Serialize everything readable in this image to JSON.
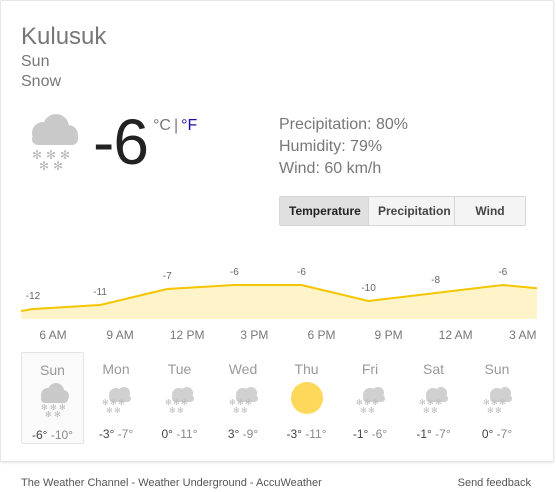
{
  "location": "Kulusuk",
  "day": "Sun",
  "condition": "Snow",
  "current": {
    "temp": "-6",
    "unit_c": "°C",
    "unit_sep": "|",
    "unit_f": "°F",
    "icon": "snow-cloud-icon"
  },
  "details": {
    "precipitation": "Precipitation: 80%",
    "humidity": "Humidity: 79%",
    "wind": "Wind: 60 km/h"
  },
  "tabs": [
    {
      "label": "Temperature",
      "active": true
    },
    {
      "label": "Precipitation",
      "active": false
    },
    {
      "label": "Wind",
      "active": false
    }
  ],
  "hourly": {
    "labels": [
      "-12",
      "-11",
      "-7",
      "-6",
      "-6",
      "-10",
      "-8",
      "-6"
    ],
    "values": [
      -12,
      -11,
      -7,
      -6,
      -6,
      -10,
      -8,
      -6
    ],
    "times": [
      "6 AM",
      "9 AM",
      "12 PM",
      "3 PM",
      "6 PM",
      "9 PM",
      "12 AM",
      "3 AM"
    ],
    "color": "#f4c500",
    "fill": "#fff4c9"
  },
  "forecast": [
    {
      "day": "Sun",
      "hi": "-6°",
      "lo": "-10°",
      "icon": "snow-cloud-icon",
      "selected": true
    },
    {
      "day": "Mon",
      "hi": "-3°",
      "lo": "-7°",
      "icon": "snow-cloud-icon",
      "selected": false
    },
    {
      "day": "Tue",
      "hi": "0°",
      "lo": "-11°",
      "icon": "snow-cloud-icon",
      "selected": false
    },
    {
      "day": "Wed",
      "hi": "3°",
      "lo": "-9°",
      "icon": "snow-cloud-icon",
      "selected": false
    },
    {
      "day": "Thu",
      "hi": "-3°",
      "lo": "-11°",
      "icon": "sun-icon",
      "selected": false
    },
    {
      "day": "Fri",
      "hi": "-1°",
      "lo": "-6°",
      "icon": "snow-cloud-icon",
      "selected": false
    },
    {
      "day": "Sat",
      "hi": "-1°",
      "lo": "-7°",
      "icon": "snow-cloud-icon",
      "selected": false
    },
    {
      "day": "Sun",
      "hi": "0°",
      "lo": "-7°",
      "icon": "snow-cloud-icon",
      "selected": false
    }
  ],
  "footer": {
    "sources": "The Weather Channel - Weather Underground - AccuWeather",
    "feedback": "Send feedback"
  }
}
